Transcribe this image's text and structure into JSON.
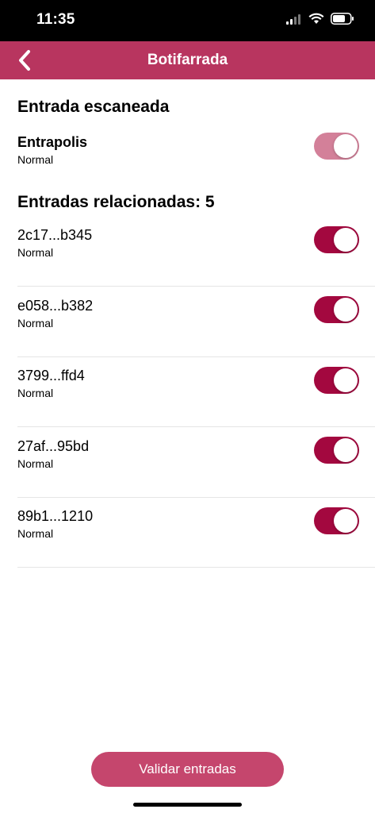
{
  "status_bar": {
    "time": "11:35",
    "icons": [
      "signal-icon",
      "wifi-icon",
      "battery-icon"
    ]
  },
  "nav": {
    "title": "Botifarrada",
    "back_icon": "chevron-left-icon"
  },
  "scanned": {
    "heading": "Entrada escaneada",
    "name": "Entrapolis",
    "type": "Normal",
    "toggle_on": true
  },
  "related": {
    "heading": "Entradas relacionadas: 5",
    "items": [
      {
        "code": "2c17...b345",
        "type": "Normal",
        "toggle_on": true
      },
      {
        "code": "e058...b382",
        "type": "Normal",
        "toggle_on": true
      },
      {
        "code": "3799...ffd4",
        "type": "Normal",
        "toggle_on": true
      },
      {
        "code": "27af...95bd",
        "type": "Normal",
        "toggle_on": true
      },
      {
        "code": "89b1...1210",
        "type": "Normal",
        "toggle_on": true
      }
    ]
  },
  "actions": {
    "validate_label": "Validar entradas"
  },
  "colors": {
    "brand": "#b8355f",
    "toggle_on": "#a3083f",
    "toggle_disabled": "#d38099",
    "button": "#c5466d"
  }
}
